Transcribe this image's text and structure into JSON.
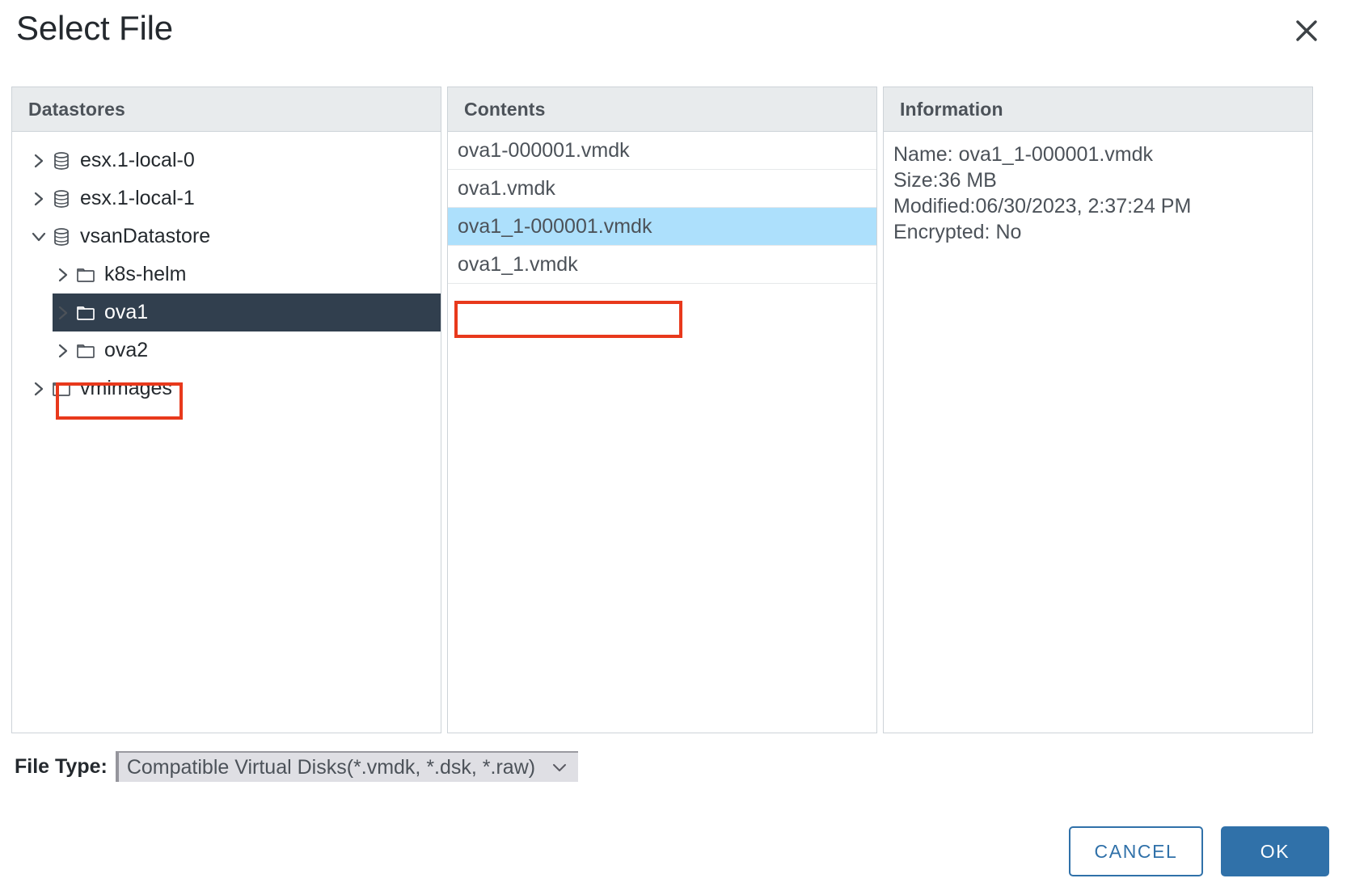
{
  "dialog": {
    "title": "Select File",
    "close_icon": "close-icon"
  },
  "panels": {
    "datastores": {
      "header": "Datastores"
    },
    "contents": {
      "header": "Contents"
    },
    "information": {
      "header": "Information"
    }
  },
  "tree": [
    {
      "label": "esx.1-local-0",
      "icon": "datastore-icon",
      "caret": "chevron-right-icon",
      "indent": 0,
      "selected": false
    },
    {
      "label": "esx.1-local-1",
      "icon": "datastore-icon",
      "caret": "chevron-right-icon",
      "indent": 0,
      "selected": false
    },
    {
      "label": "vsanDatastore",
      "icon": "datastore-icon",
      "caret": "chevron-down-icon",
      "indent": 0,
      "selected": false
    },
    {
      "label": "k8s-helm",
      "icon": "folder-icon",
      "caret": "chevron-right-icon",
      "indent": 1,
      "selected": false
    },
    {
      "label": "ova1",
      "icon": "folder-icon",
      "caret": "chevron-right-icon",
      "indent": 1,
      "selected": true
    },
    {
      "label": "ova2",
      "icon": "folder-icon",
      "caret": "chevron-right-icon",
      "indent": 1,
      "selected": false
    },
    {
      "label": "vmimages",
      "icon": "folder-icon",
      "caret": "chevron-right-icon",
      "indent": 0,
      "selected": false
    }
  ],
  "contents": [
    {
      "name": "ova1-000001.vmdk",
      "selected": false
    },
    {
      "name": "ova1.vmdk",
      "selected": false
    },
    {
      "name": "ova1_1-000001.vmdk",
      "selected": true
    },
    {
      "name": "ova1_1.vmdk",
      "selected": false
    }
  ],
  "information": [
    "Name: ova1_1-000001.vmdk",
    "Size:36 MB",
    "Modified:06/30/2023, 2:37:24 PM",
    "Encrypted: No"
  ],
  "file_type": {
    "label": "File Type:",
    "value": "Compatible Virtual Disks(*.vmdk, *.dsk, *.raw)",
    "caret_icon": "chevron-down-icon"
  },
  "footer": {
    "cancel_label": "CANCEL",
    "ok_label": "OK"
  },
  "colors": {
    "accent": "#3071a9",
    "selection_dark": "#313f4e",
    "selection_light": "#ade0fc",
    "annotation": "#e8391c",
    "header_bg": "#e8ebed"
  }
}
